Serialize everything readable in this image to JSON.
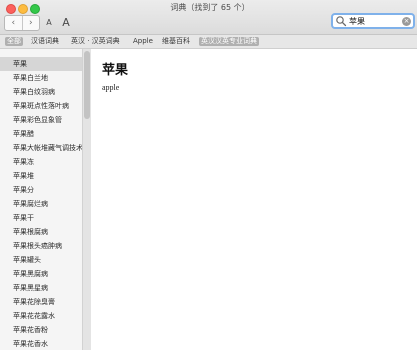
{
  "window": {
    "title": "词典（找到了 65 个）"
  },
  "toolbar": {
    "back_symbol": "‹",
    "forward_symbol": "›",
    "font_smaller_label": "A",
    "font_larger_label": "A"
  },
  "search": {
    "value": "苹果",
    "clear_symbol": "×"
  },
  "tabs": [
    {
      "label": "全部",
      "active": true
    },
    {
      "label": "汉语词典",
      "active": false
    },
    {
      "label": "英汉 · 汉英词典",
      "active": false
    },
    {
      "label": "Apple",
      "active": false
    },
    {
      "label": "维基百科",
      "active": false
    },
    {
      "label": "英汉汉英专业词典",
      "active": false
    }
  ],
  "sidebar": {
    "selected_index": 0,
    "items": [
      "苹果",
      "苹果白兰地",
      "苹果白纹羽病",
      "苹果斑点性落叶病",
      "苹果彩色显象管",
      "苹果醋",
      "苹果大帐堆藏气调技术",
      "苹果冻",
      "苹果堆",
      "苹果分",
      "苹果腐烂病",
      "苹果干",
      "苹果根腐病",
      "苹果根头癌肿病",
      "苹果罐头",
      "苹果黑腐病",
      "苹果黑星病",
      "苹果花除臭膏",
      "苹果花花露水",
      "苹果花香粉",
      "苹果花香水"
    ]
  },
  "entry": {
    "headword": "苹果",
    "definition": "apple"
  },
  "colors": {
    "search_focus": "#7fb1ea",
    "selected_row": "#d6d6d6",
    "active_tab": "#b0b0b0"
  }
}
